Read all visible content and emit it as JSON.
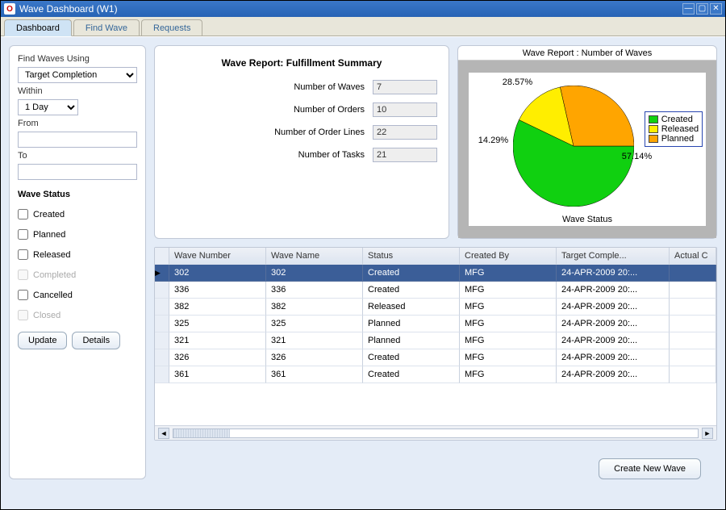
{
  "window": {
    "title": "Wave Dashboard (W1)"
  },
  "tabs": {
    "t0": "Dashboard",
    "t1": "Find Wave",
    "t2": "Requests"
  },
  "filter": {
    "using_label": "Find Waves Using",
    "using_value": "Target Completion",
    "within_label": "Within",
    "within_value": "1 Day",
    "from_label": "From",
    "from_value": "",
    "to_label": "To",
    "to_value": ""
  },
  "status": {
    "heading": "Wave Status",
    "created": "Created",
    "planned": "Planned",
    "released": "Released",
    "completed": "Completed",
    "cancelled": "Cancelled",
    "closed": "Closed"
  },
  "buttons": {
    "update": "Update",
    "details": "Details",
    "create_new": "Create New Wave"
  },
  "summary": {
    "title": "Wave Report: Fulfillment Summary",
    "label_waves": "Number of Waves",
    "val_waves": "7",
    "label_orders": "Number of Orders",
    "val_orders": "10",
    "label_lines": "Number of Order Lines",
    "val_lines": "22",
    "label_tasks": "Number of Tasks",
    "val_tasks": "21"
  },
  "chart_data": {
    "type": "pie",
    "title": "Wave Report : Number of Waves",
    "xlabel": "Wave Status",
    "series": [
      {
        "name": "Created",
        "value": 57.14,
        "color": "#10d010"
      },
      {
        "name": "Released",
        "value": 14.29,
        "color": "#ffee00"
      },
      {
        "name": "Planned",
        "value": 28.57,
        "color": "#ffa500"
      }
    ]
  },
  "table": {
    "columns": {
      "c1": "Wave Number",
      "c2": "Wave Name",
      "c3": "Status",
      "c4": "Created By",
      "c5": "Target Comple...",
      "c6": "Actual C"
    },
    "rows": [
      {
        "c1": "302",
        "c2": "302",
        "c3": "Created",
        "c4": "MFG",
        "c5": "24-APR-2009 20:..."
      },
      {
        "c1": "336",
        "c2": "336",
        "c3": "Created",
        "c4": "MFG",
        "c5": "24-APR-2009 20:..."
      },
      {
        "c1": "382",
        "c2": "382",
        "c3": "Released",
        "c4": "MFG",
        "c5": "24-APR-2009 20:..."
      },
      {
        "c1": "325",
        "c2": "325",
        "c3": "Planned",
        "c4": "MFG",
        "c5": "24-APR-2009 20:..."
      },
      {
        "c1": "321",
        "c2": "321",
        "c3": "Planned",
        "c4": "MFG",
        "c5": "24-APR-2009 20:..."
      },
      {
        "c1": "326",
        "c2": "326",
        "c3": "Created",
        "c4": "MFG",
        "c5": "24-APR-2009 20:..."
      },
      {
        "c1": "361",
        "c2": "361",
        "c3": "Created",
        "c4": "MFG",
        "c5": "24-APR-2009 20:..."
      }
    ]
  }
}
